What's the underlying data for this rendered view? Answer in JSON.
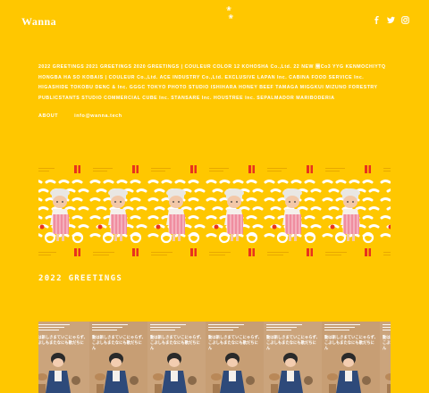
{
  "header": {
    "logo": "Wanna",
    "social": [
      {
        "icon": "facebook-icon"
      },
      {
        "icon": "twitter-icon"
      },
      {
        "icon": "instagram-icon"
      }
    ]
  },
  "clients_text": "2022 GREETINGS 2021 GREETINGS 2020 GREETINGS | COULEUR COLOR 12 KOHOSHA Co.,Ltd. 22 NEW 圏Co3 YYG KENMOCHIYTQ HONGBA HA SO KOBAIS | COULEUR Co.,Ltd. ACE INDUSTRY Co.,Ltd. EXCLUSIVE LAPAN Inc. CABINA FOOD SERVICE Inc. HIGASHIDE TOKOBU DENC & Inc. GGGC TOKYO PHOTO STUDIO ISHIHARA HONEY BEEF TAMAGA MIGGKUI MIZUNO FORESTRY PUBLICSTANTS STUDIO COMMERCIAL CUBE Inc. STANSARE Inc. HOUSTREE Inc. SEPALMADOR MARIBODERIA",
  "nav": {
    "about": "ABOUT",
    "email": "info@wanna.tech"
  },
  "section": {
    "title": "2022 GREETINGS"
  },
  "cards_text": {
    "jp_line1": "動は新しさまていこにゃらず、",
    "jp_line2": "こぶしもまたなにも歌だちにん"
  },
  "colors": {
    "background": "#FFC700",
    "accent_red": "#E8321E",
    "kraft": "#C9A27A"
  }
}
